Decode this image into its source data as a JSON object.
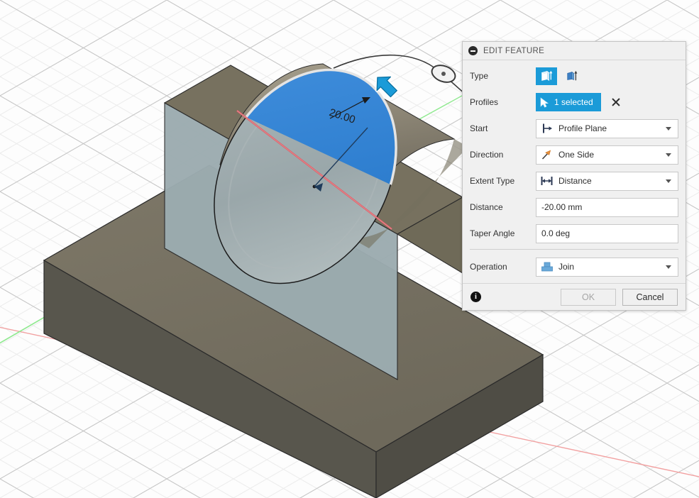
{
  "app": {
    "name": "Fusion 360 CAD Viewport"
  },
  "viewport": {
    "dimension_label": "20.00",
    "grid": {
      "minor_color": "#e9e9e9",
      "major_color": "#c9c9c9",
      "background_color": "#fdfdfd"
    },
    "axes": {
      "x_axis_color": "#f08b8b",
      "y_axis_color": "#7fe07f"
    },
    "model_colors": {
      "top_face": "#75705f",
      "front_face": "#5c5a50",
      "side_face_light": "#9aaaae",
      "cylinder_body": "#8d887a",
      "selected_profile": "#2f7fd0",
      "profile_highlight_edge": "#e8e8e8",
      "red_edge": "#e05a5a",
      "manipulator_arrow": "#1b9bd8",
      "manipulator_outline": "#ffffff"
    }
  },
  "dialog": {
    "title": "EDIT FEATURE",
    "collapse_icon": "minus-circle-icon",
    "rows": {
      "type": {
        "label": "Type",
        "options": [
          {
            "icon": "extrude-solid-icon",
            "selected": true
          },
          {
            "icon": "extrude-thin-icon",
            "selected": false
          }
        ]
      },
      "profiles": {
        "label": "Profiles",
        "chip_icon": "cursor-arrow-icon",
        "chip_text": "1 selected",
        "clear_icon": "close-x-icon"
      },
      "start": {
        "label": "Start",
        "icon": "profile-plane-icon",
        "value": "Profile Plane"
      },
      "direction": {
        "label": "Direction",
        "icon": "one-side-flag-icon",
        "value": "One Side"
      },
      "extent_type": {
        "label": "Extent Type",
        "icon": "distance-arrows-icon",
        "value": "Distance"
      },
      "distance": {
        "label": "Distance",
        "value": "-20.00 mm",
        "placeholder": ""
      },
      "taper_angle": {
        "label": "Taper Angle",
        "value": "0.0 deg",
        "placeholder": ""
      },
      "operation": {
        "label": "Operation",
        "icon": "join-operation-icon",
        "value": "Join"
      }
    },
    "footer": {
      "info_icon": "info-icon",
      "ok_label": "OK",
      "ok_enabled": false,
      "cancel_label": "Cancel",
      "cancel_enabled": true
    },
    "accent_color": "#1b9bd8"
  }
}
